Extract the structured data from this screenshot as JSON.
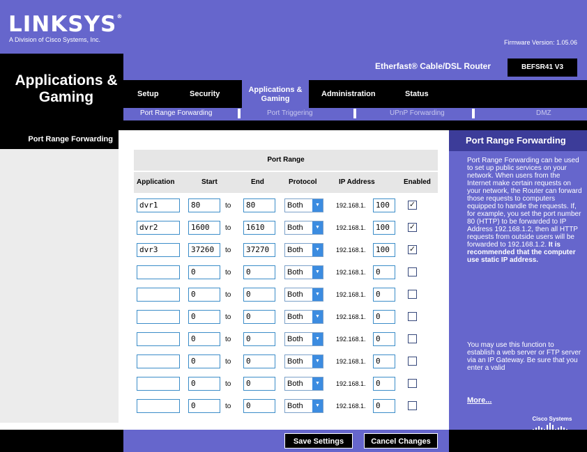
{
  "brand": {
    "logo": "LINKSYS",
    "logo_mark": "®",
    "subtitle": "A Division of Cisco Systems, Inc.",
    "firmware": "Firmware Version: 1.05.06"
  },
  "section_title": "Applications & Gaming",
  "product": {
    "name": "Etherfast® Cable/DSL Router",
    "model": "BEFSR41 V3"
  },
  "tabs": [
    {
      "label": "Setup"
    },
    {
      "label": "Security"
    },
    {
      "label": "Applications & Gaming"
    },
    {
      "label": "Administration"
    },
    {
      "label": "Status"
    }
  ],
  "subtabs": [
    {
      "label": "Port Range Forwarding"
    },
    {
      "label": "Port Triggering"
    },
    {
      "label": "UPnP Forwarding"
    },
    {
      "label": "DMZ"
    }
  ],
  "left_title": "Port Range Forwarding",
  "table": {
    "group_header": "Port Range",
    "headers": {
      "application": "Application",
      "start": "Start",
      "end": "End",
      "protocol": "Protocol",
      "ip": "IP Address",
      "enabled": "Enabled"
    },
    "to_label": "to",
    "ip_prefix": "192.168.1.",
    "rows": [
      {
        "app": "dvr1",
        "start": "80",
        "end": "80",
        "protocol": "Both",
        "ip": "100",
        "enabled": true
      },
      {
        "app": "dvr2",
        "start": "1600",
        "end": "1610",
        "protocol": "Both",
        "ip": "100",
        "enabled": true
      },
      {
        "app": "dvr3",
        "start": "37260",
        "end": "37270",
        "protocol": "Both",
        "ip": "100",
        "enabled": true
      },
      {
        "app": "",
        "start": "0",
        "end": "0",
        "protocol": "Both",
        "ip": "0",
        "enabled": false
      },
      {
        "app": "",
        "start": "0",
        "end": "0",
        "protocol": "Both",
        "ip": "0",
        "enabled": false
      },
      {
        "app": "",
        "start": "0",
        "end": "0",
        "protocol": "Both",
        "ip": "0",
        "enabled": false
      },
      {
        "app": "",
        "start": "0",
        "end": "0",
        "protocol": "Both",
        "ip": "0",
        "enabled": false
      },
      {
        "app": "",
        "start": "0",
        "end": "0",
        "protocol": "Both",
        "ip": "0",
        "enabled": false
      },
      {
        "app": "",
        "start": "0",
        "end": "0",
        "protocol": "Both",
        "ip": "0",
        "enabled": false
      },
      {
        "app": "",
        "start": "0",
        "end": "0",
        "protocol": "Both",
        "ip": "0",
        "enabled": false
      }
    ]
  },
  "help": {
    "title": "Port Range Forwarding",
    "text1": "Port Range Forwarding can be used to set up public services on your network. When users from the Internet make certain requests on your network, the Router can forward those requests to computers equipped to handle the requests. If, for example, you set the port number 80 (HTTP) to be forwarded to IP Address 192.168.1.2, then all HTTP requests from outside users will be forwarded to 192.168.1.2.",
    "text1_bold": "It is recommended that the computer use static IP address.",
    "text2": "You may use this function to establish a web server or FTP server via an IP Gateway. Be sure that you enter a valid",
    "more": "More...",
    "cisco": "Cisco Systems"
  },
  "buttons": {
    "save": "Save Settings",
    "cancel": "Cancel Changes"
  },
  "colors": {
    "purple": "#6666cc",
    "dark_purple": "#3c3c99",
    "black": "#000000",
    "select_arrow": "#3c8ce0"
  }
}
